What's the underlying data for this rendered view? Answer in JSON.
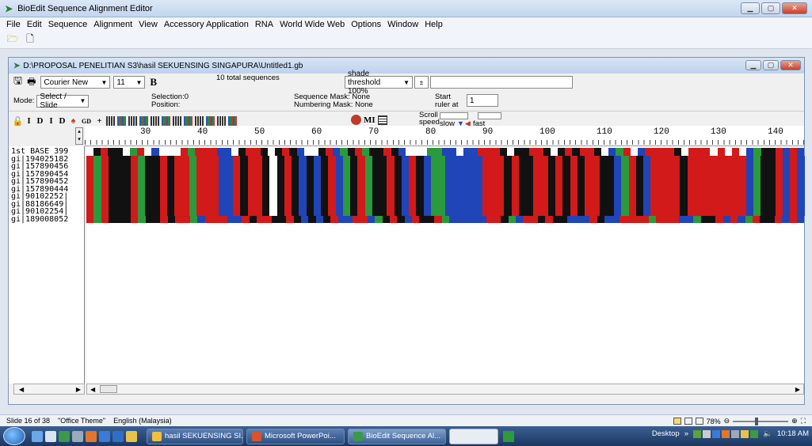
{
  "app": {
    "title": "BioEdit Sequence Alignment Editor"
  },
  "menu": [
    "File",
    "Edit",
    "Sequence",
    "Alignment",
    "View",
    "Accessory Application",
    "RNA",
    "World Wide Web",
    "Options",
    "Window",
    "Help"
  ],
  "doc": {
    "path": "D:\\PROPOSAL PENELITIAN S3\\hasil SEKUENSING SINGAPURA\\Untitled1.gb",
    "font_name": "Courier New",
    "font_size": "11",
    "bold_label": "B",
    "total_sequences": "10 total sequences",
    "shade_threshold": "shade threshold 100%",
    "mode_label": "Mode:",
    "mode_value": "Select / Slide",
    "selection_label": "Selection:",
    "selection_value": "0",
    "position_label": "Position:",
    "sequence_mask": "Sequence Mask: None",
    "numbering_mask": "Numbering Mask: None",
    "start_ruler_label": "Start ruler at",
    "start_ruler_value": "1",
    "scroll_speed_label": "Scroll speed",
    "slow_label": "slow",
    "fast_label": "fast",
    "ml_label": "MI"
  },
  "ruler": [
    "30",
    "40",
    "50",
    "60",
    "70",
    "80",
    "90",
    "100",
    "110",
    "120",
    "130",
    "140"
  ],
  "sequence_names": [
    "1st BASE 399",
    "gi|194025182",
    "gi|157890456",
    "gi|157890454",
    "gi|157890452",
    "gi|157890444",
    "gi|90102252|",
    "gi|88186649|",
    "gi|90102254|",
    "gi|189008052"
  ],
  "base_colors": {
    "A": "#d21a1a",
    "C": "#1f45b8",
    "G": "#111111",
    "T": "#2b9a3c",
    "N": "#ffffff"
  },
  "status": {
    "slide": "Slide 16 of 38",
    "theme": "\"Office Theme\"",
    "language": "English (Malaysia)",
    "zoom": "78%"
  },
  "taskbar": {
    "items": [
      "hasil SEKUENSING SI...",
      "Microsoft PowerPoi...",
      "BioEdit Sequence Al..."
    ],
    "desktop": "Desktop",
    "time": "10:18 AM"
  }
}
